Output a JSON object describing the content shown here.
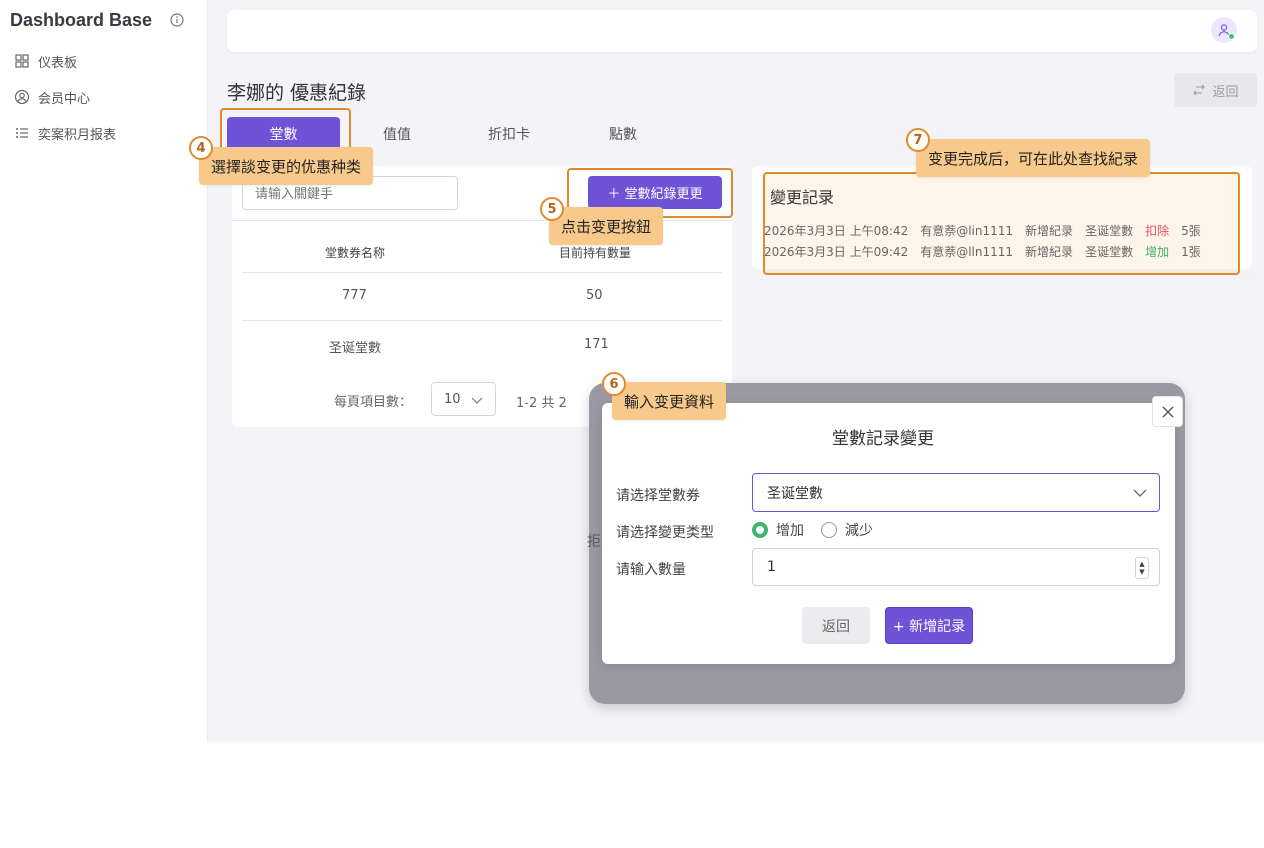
{
  "sidebar": {
    "brand": "Dashboard Base",
    "items": [
      {
        "label": "仪表板",
        "icon": "grid-icon"
      },
      {
        "label": "会员中心",
        "icon": "user-circle-icon"
      },
      {
        "label": "奕案积月报表",
        "icon": "list-icon"
      }
    ]
  },
  "header": {
    "avatar_icon": "user-icon",
    "status_color": "#3fc46f"
  },
  "page": {
    "title": "李娜的 優惠紀錄",
    "back_label": "返回"
  },
  "tabs": [
    {
      "label": "堂數",
      "active": true
    },
    {
      "label": "值值",
      "active": false
    },
    {
      "label": "折扣卡",
      "active": false
    },
    {
      "label": "點數",
      "active": false
    }
  ],
  "coupon_panel": {
    "search_placeholder": "请输入關鍵手",
    "add_button": "＋ 堂數紀錄更更",
    "columns": [
      "堂數券名称",
      "目前持有數量"
    ],
    "rows": [
      {
        "name": "777",
        "qty": "50"
      },
      {
        "name": "圣诞堂數",
        "qty": "171"
      }
    ],
    "pager_label": "每頁項目數：",
    "page_size": "10",
    "range": "1-2 共 2"
  },
  "log_panel": {
    "title": "變更記录",
    "rows": [
      {
        "time": "2026年3月3日 上午08:42",
        "user": "有意萘@lin1111",
        "action": "新增紀录",
        "coupon": "圣诞堂數",
        "change": "扣除",
        "qty": "5張",
        "type": "minus"
      },
      {
        "time": "2026年3月3日 上午09:42",
        "user": "有意萘@lln1111",
        "action": "新增紀录",
        "coupon": "圣诞堂數",
        "change": "增加",
        "qty": "1張",
        "type": "plus"
      }
    ]
  },
  "modal": {
    "title": "堂數記录變更",
    "select_label": "请选择堂數券",
    "select_value": "圣诞堂數",
    "type_label": "请选择變更类型",
    "type_options": [
      "增加",
      "減少"
    ],
    "qty_label": "请输入數量",
    "qty_value": "1",
    "back_button": "返回",
    "submit_button": "+ 新增記录",
    "behind_hint": "拒"
  },
  "callouts": [
    {
      "step": "4",
      "text": "選擇談变更的优惠种类"
    },
    {
      "step": "5",
      "text": "点击变更按鈕"
    },
    {
      "step": "6",
      "text": "輸入变更資料"
    },
    {
      "step": "7",
      "text": "变更完成后，可在此处查找紀录"
    }
  ],
  "colors": {
    "accent": "#6f53d6",
    "highlight": "#e08a2e",
    "callout_bg": "#f7c98a",
    "minus": "#e25461",
    "plus": "#3cb46e"
  }
}
